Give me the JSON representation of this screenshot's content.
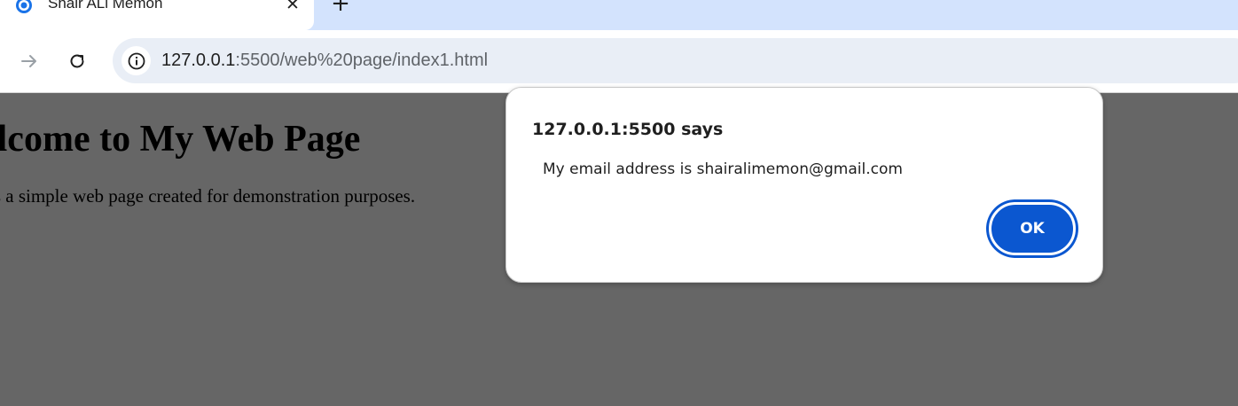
{
  "browser": {
    "tab": {
      "title": "Shair ALi Memon",
      "favicon": "chrome-app-icon",
      "close_icon": "close-icon"
    },
    "new_tab_icon": "plus-icon",
    "toolbar": {
      "forward_icon": "arrow-right-icon",
      "reload_icon": "reload-icon",
      "site_info_icon": "info-icon"
    },
    "url": {
      "host": "127.0.0.1",
      "path": ":5500/web%20page/index1.html"
    }
  },
  "page": {
    "heading": "elcome to My Web Page",
    "paragraph": "is a simple web page created for demonstration purposes."
  },
  "dialog": {
    "title": "127.0.0.1:5500 says",
    "message": "My email address is shairalimemon@gmail.com",
    "ok_label": "OK"
  },
  "colors": {
    "tabstrip_bg": "#d3e3fd",
    "omnibox_bg": "#e9eef6",
    "overlay_bg": "#666666",
    "accent": "#0b57d0"
  }
}
